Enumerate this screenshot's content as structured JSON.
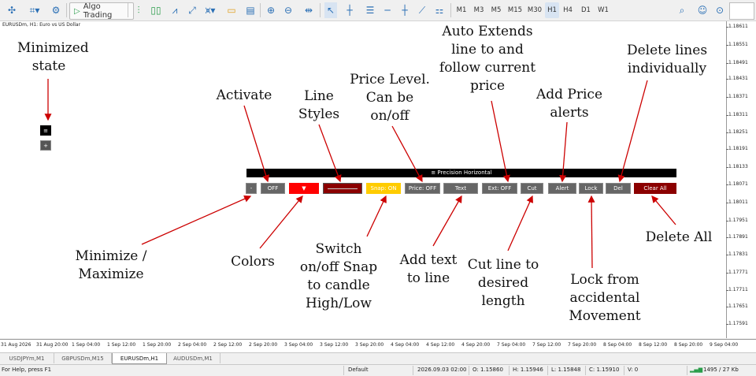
{
  "toolbar": {
    "algo_trading_label": "Algo Trading",
    "timeframes": [
      "M1",
      "M3",
      "M5",
      "M15",
      "M30",
      "H1",
      "H4",
      "D1",
      "W1"
    ],
    "active_timeframe": "H1"
  },
  "chart": {
    "title": "EURUSDm, H1:  Euro vs US Dollar",
    "y_ticks": [
      "1.18611",
      "1.18551",
      "1.18491",
      "1.18431",
      "1.18371",
      "1.18311",
      "1.18251",
      "1.18191",
      "1.18133",
      "1.18071",
      "1.18011",
      "1.17951",
      "1.17891",
      "1.17831",
      "1.17771",
      "1.17711",
      "1.17651",
      "1.17591"
    ],
    "x_ticks": [
      "31 Aug 2026",
      "31 Aug 20:00",
      "1 Sep 04:00",
      "1 Sep 12:00",
      "1 Sep 20:00",
      "2 Sep 04:00",
      "2 Sep 12:00",
      "2 Sep 20:00",
      "3 Sep 04:00",
      "3 Sep 12:00",
      "3 Sep 20:00",
      "4 Sep 04:00",
      "4 Sep 12:00",
      "4 Sep 20:00",
      "7 Sep 04:00",
      "7 Sep 12:00",
      "7 Sep 20:00",
      "8 Sep 04:00",
      "8 Sep 12:00",
      "8 Sep 20:00",
      "9 Sep 04:00"
    ]
  },
  "panel": {
    "title": "≡ Precision Horizontal",
    "minimize_label": "-",
    "activate_label": "OFF",
    "color_label": "▼",
    "snap_label": "Snap: ON",
    "price_label": "Price: OFF",
    "text_label": "Text",
    "extend_label": "Ext: OFF",
    "cut_label": "Cut",
    "alert_label": "Alert",
    "lock_label": "Lock",
    "del_label": "Del",
    "clear_all_label": "Clear All",
    "mini_menu_label": "≡",
    "mini_plus_label": "+"
  },
  "annotations": {
    "minimized_state": [
      "Minimized",
      "state"
    ],
    "activate": [
      "Activate"
    ],
    "line_styles": [
      "Line",
      "Styles"
    ],
    "price_level": [
      "Price Level.",
      "Can be",
      "on/off"
    ],
    "auto_extends": [
      "Auto Extends",
      "line to and",
      "follow current",
      "price"
    ],
    "add_price_alerts": [
      "Add Price",
      "alerts"
    ],
    "delete_lines": [
      "Delete lines",
      "individually"
    ],
    "minimize_maximize": [
      "Minimize /",
      "Maximize"
    ],
    "colors": [
      "Colors"
    ],
    "switch_snap": [
      "Switch",
      "on/off Snap",
      "to candle",
      "High/Low"
    ],
    "add_text": [
      "Add text",
      "to line"
    ],
    "cut_line": [
      "Cut line to",
      "desired",
      "length"
    ],
    "lock": [
      "Lock from",
      "accidental",
      "Movement"
    ],
    "delete_all": [
      "Delete All"
    ]
  },
  "tabs": [
    "USDJPYm,M1",
    "GBPUSDm,M15",
    "EURUSDm,H1",
    "AUDUSDm,M1"
  ],
  "active_tab": "EURUSDm,H1",
  "status": {
    "help": "For Help, press F1",
    "profile": "Default",
    "datetime": "2026.09.03 02:00",
    "open": "O: 1.15860",
    "high": "H: 1.15946",
    "low": "L: 1.15848",
    "close": "C: 1.15910",
    "volume": "V: 0",
    "traffic": "1495 / 27 Kb"
  },
  "colors": {
    "activate_button": "#666666",
    "color_button": "#ff0000",
    "snap_button": "#ffcc00",
    "clear_all_button": "#8b0000",
    "panel_title_bg": "#000000",
    "arrow": "#cc0000"
  }
}
